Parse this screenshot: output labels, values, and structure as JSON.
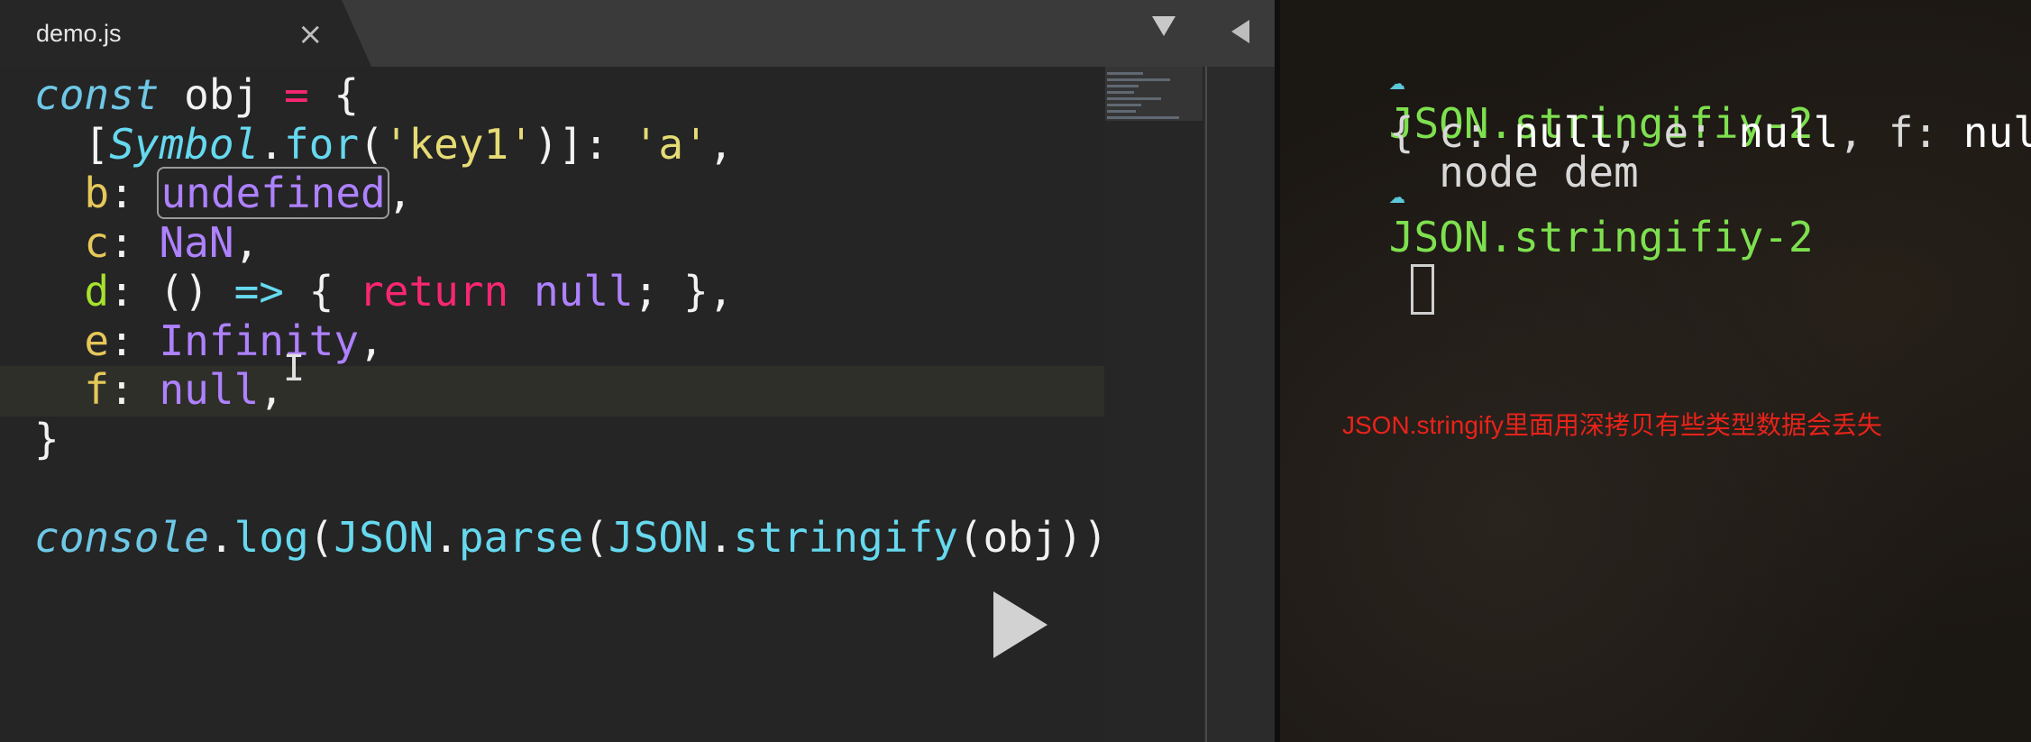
{
  "editor": {
    "tab": {
      "label": "demo.js",
      "close": "×"
    },
    "code_lines": [
      [
        {
          "t": "const",
          "c": "kw"
        },
        {
          "t": " obj ",
          "c": ""
        },
        {
          "t": "=",
          "c": "op"
        },
        {
          "t": " {",
          "c": ""
        }
      ],
      [
        {
          "t": "  [",
          "c": ""
        },
        {
          "t": "Symbol",
          "c": "cls"
        },
        {
          "t": ".",
          "c": ""
        },
        {
          "t": "for",
          "c": "fn"
        },
        {
          "t": "(",
          "c": ""
        },
        {
          "t": "'key1'",
          "c": "str"
        },
        {
          "t": ")]: ",
          "c": ""
        },
        {
          "t": "'a'",
          "c": "str"
        },
        {
          "t": ",",
          "c": ""
        }
      ],
      [
        {
          "t": "  ",
          "c": ""
        },
        {
          "t": "b",
          "c": "prop2"
        },
        {
          "t": ": ",
          "c": ""
        },
        {
          "t": "undefined",
          "c": "const",
          "id": "hl-undef"
        },
        {
          "t": ",",
          "c": ""
        }
      ],
      [
        {
          "t": "  ",
          "c": ""
        },
        {
          "t": "c",
          "c": "prop2"
        },
        {
          "t": ": ",
          "c": ""
        },
        {
          "t": "NaN",
          "c": "const"
        },
        {
          "t": ",",
          "c": ""
        }
      ],
      [
        {
          "t": "  ",
          "c": ""
        },
        {
          "t": "d",
          "c": "prop"
        },
        {
          "t": ": () ",
          "c": ""
        },
        {
          "t": "=>",
          "c": "fn"
        },
        {
          "t": " { ",
          "c": ""
        },
        {
          "t": "return",
          "c": "ret"
        },
        {
          "t": " ",
          "c": ""
        },
        {
          "t": "null",
          "c": "const"
        },
        {
          "t": "; },",
          "c": ""
        }
      ],
      [
        {
          "t": "  ",
          "c": ""
        },
        {
          "t": "e",
          "c": "prop2"
        },
        {
          "t": ": ",
          "c": ""
        },
        {
          "t": "Infinity",
          "c": "const"
        },
        {
          "t": ",",
          "c": ""
        }
      ],
      [
        {
          "t": "  ",
          "c": ""
        },
        {
          "t": "f",
          "c": "prop2"
        },
        {
          "t": ": ",
          "c": ""
        },
        {
          "t": "null",
          "c": "const"
        },
        {
          "t": ",",
          "c": ""
        }
      ],
      [
        {
          "t": "}",
          "c": ""
        }
      ],
      [
        {
          "t": "",
          "c": ""
        }
      ],
      [
        {
          "t": "console",
          "c": "kw"
        },
        {
          "t": ".",
          "c": ""
        },
        {
          "t": "log",
          "c": "fn"
        },
        {
          "t": "(",
          "c": ""
        },
        {
          "t": "JSON",
          "c": "fn"
        },
        {
          "t": ".",
          "c": ""
        },
        {
          "t": "parse",
          "c": "fn"
        },
        {
          "t": "(",
          "c": ""
        },
        {
          "t": "JSON",
          "c": "fn"
        },
        {
          "t": ".",
          "c": ""
        },
        {
          "t": "stringify",
          "c": "fn"
        },
        {
          "t": "(obj)))",
          "c": ""
        }
      ]
    ]
  },
  "terminal": {
    "line1": {
      "icon": "☁",
      "dir": "JSON.stringifiy-2",
      "cmd": "  node dem"
    },
    "output": {
      "open": "{ ",
      "c_key": "c: ",
      "c_val": "null",
      "e_key": ", e: ",
      "e_val": "null",
      "f_key": ", f: ",
      "f_val": "null",
      "close": " }"
    },
    "line2": {
      "icon": "☁",
      "dir": "JSON.stringifiy-2"
    }
  },
  "annotation": "JSON.stringify里面用深拷贝有些类型数据会丢失",
  "icons": {
    "play": "play-icon",
    "tab_menu": "triangle-down-icon",
    "tab_back": "triangle-left-icon",
    "cursor": "ibeam-cursor-icon"
  }
}
